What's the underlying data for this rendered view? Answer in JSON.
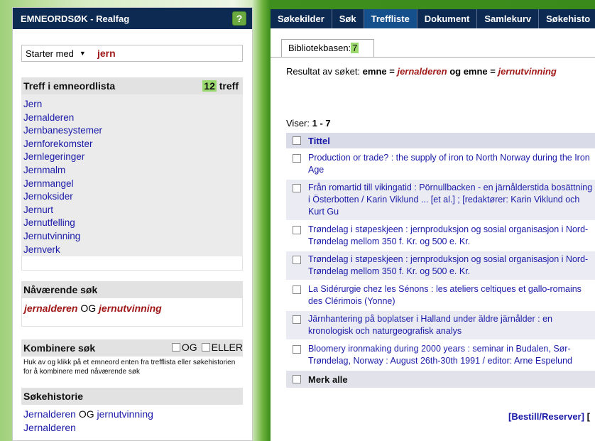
{
  "left": {
    "header_title": "EMNEORDSØK - Realfag",
    "help_label": "?",
    "search_mode": "Starter med",
    "search_value": "jern",
    "treff": {
      "title": "Treff i emneordlista",
      "count": "12",
      "count_suffix": "treff",
      "terms": [
        "Jern",
        "Jernalderen",
        "Jernbanesystemer",
        "Jernforekomster",
        "Jernlegeringer",
        "Jernmalm",
        "Jernmangel",
        "Jernoksider",
        "Jernurt",
        "Jernutfelling",
        "Jernutvinning",
        "Jernverk"
      ]
    },
    "current_search": {
      "title": "Nåværende søk",
      "term1": "jernalderen",
      "op": "OG",
      "term2": "jernutvinning"
    },
    "combine": {
      "title": "Kombinere søk",
      "og_label": "OG",
      "eller_label": "ELLER",
      "help": "Huk av og klikk på et emneord enten fra trefflista eller søkehistorien for å kombinere med nåværende søk"
    },
    "history": {
      "title": "Søkehistorie",
      "item1_a": "Jernalderen",
      "item1_op": "OG",
      "item1_b": "jernutvinning",
      "item2": "Jernalderen"
    }
  },
  "right": {
    "tabs": [
      "Søkekilder",
      "Søk",
      "Treffliste",
      "Dokument",
      "Samlekurv",
      "Søkehisto"
    ],
    "active_tab": "Treffliste",
    "biblio_label": "Bibliotekbasen:",
    "biblio_count": "7",
    "result_prefix": "Resultat av søket:",
    "result_field1": "emne =",
    "result_term1": "jernalderen",
    "result_op": "og",
    "result_field2": "emne =",
    "result_term2": "jernutvinning",
    "viser_label": "Viser:",
    "viser_range": "1 - 7",
    "title_header": "Tittel",
    "results": [
      "Production or trade? : the supply of iron to North Norway during the Iron Age",
      "Från romartid till vikingatid : Pörnullbacken - en järnålderstida bosättning i Österbotten / Karin Viklund ... [et al.] ; [redaktører: Karin Viklund och Kurt Gu",
      "Trøndelag i støpeskjeen : jernproduksjon og sosial organisasjon i Nord-Trøndelag mellom 350 f. Kr. og 500 e. Kr.",
      "Trøndelag i støpeskjeen : jernproduksjon og sosial organisasjon i Nord-Trøndelag mellom 350 f. Kr. og 500 e. Kr.",
      "La Sidérurgie chez les Sénons : les ateliers celtiques et gallo-romains des Clérimois (Yonne)",
      "Järnhantering på boplatser i Halland under äldre järnålder : en kronologisk och naturgeografisk analys",
      "Bloomery ironmaking during 2000 years : seminar in Budalen, Sør-Trøndelag, Norway : August 26th-30th 1991 / editor: Arne Espelund"
    ],
    "merk_alle": "Merk alle",
    "bestill": "[Bestill/Reserver]",
    "bestill_trail": "["
  }
}
